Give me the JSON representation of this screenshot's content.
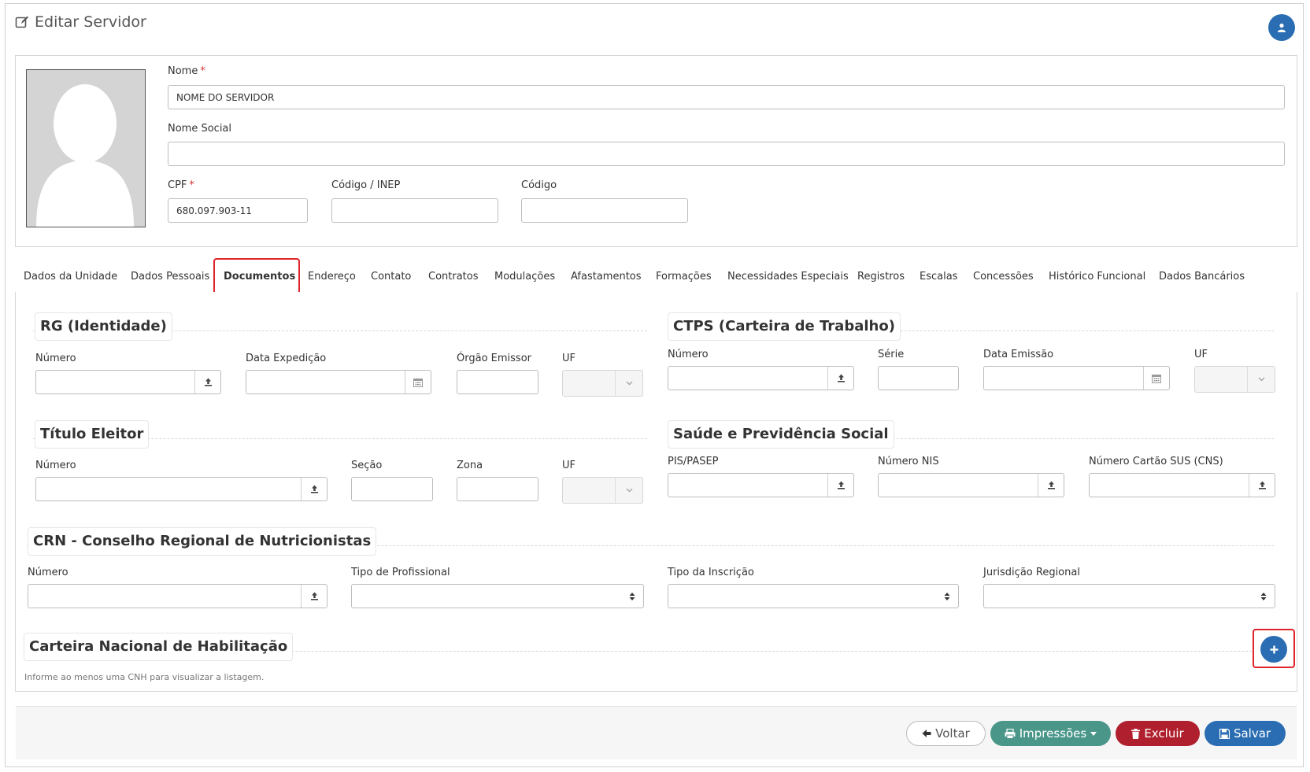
{
  "page": {
    "title": "Editar Servidor"
  },
  "identity": {
    "nome": {
      "label": "Nome",
      "value": "NOME DO SERVIDOR"
    },
    "nome_social": {
      "label": "Nome Social",
      "value": ""
    },
    "cpf": {
      "label": "CPF",
      "value": "680.097.903-11"
    },
    "codigo_inep": {
      "label": "Código / INEP",
      "value": ""
    },
    "codigo": {
      "label": "Código",
      "value": ""
    },
    "required_mark": "*"
  },
  "tabs": [
    {
      "label": "Dados da Unidade"
    },
    {
      "label": "Dados Pessoais"
    },
    {
      "label": "Documentos",
      "active": true
    },
    {
      "label": "Endereço"
    },
    {
      "label": "Contato"
    },
    {
      "label": "Contratos"
    },
    {
      "label": "Modulações"
    },
    {
      "label": "Afastamentos"
    },
    {
      "label": "Formações"
    },
    {
      "label": "Necessidades Especiais"
    },
    {
      "label": "Registros"
    },
    {
      "label": "Escalas"
    },
    {
      "label": "Concessões"
    },
    {
      "label": "Histórico Funcional"
    },
    {
      "label": "Dados Bancários"
    }
  ],
  "sections": {
    "rg": {
      "title": "RG (Identidade)",
      "numero": "Número",
      "data_expedicao": "Data Expedição",
      "orgao_emissor": "Órgão Emissor",
      "uf": "UF"
    },
    "ctps": {
      "title": "CTPS (Carteira de Trabalho)",
      "numero": "Número",
      "serie": "Série",
      "data_emissao": "Data Emissão",
      "uf": "UF"
    },
    "titulo": {
      "title": "Título Eleitor",
      "numero": "Número",
      "secao": "Seção",
      "zona": "Zona",
      "uf": "UF"
    },
    "saude": {
      "title": "Saúde e Previdência Social",
      "pis": "PIS/PASEP",
      "nis": "Número NIS",
      "sus": "Número Cartão SUS (CNS)"
    },
    "crn": {
      "title": "CRN - Conselho Regional de Nutricionistas",
      "numero": "Número",
      "tipo_profissional": "Tipo de Profissional",
      "tipo_inscricao": "Tipo da Inscrição",
      "jurisdicao": "Jurisdição Regional"
    },
    "cnh": {
      "title": "Carteira Nacional de Habilitação",
      "hint": "Informe ao menos uma CNH para visualizar a listagem."
    }
  },
  "footer": {
    "voltar": "Voltar",
    "impressoes": "Impressões",
    "excluir": "Excluir",
    "salvar": "Salvar"
  },
  "colors": {
    "primary": "#2a6db3",
    "teal": "#4a978a",
    "danger": "#b01f2d",
    "highlight": "#e0242b"
  }
}
